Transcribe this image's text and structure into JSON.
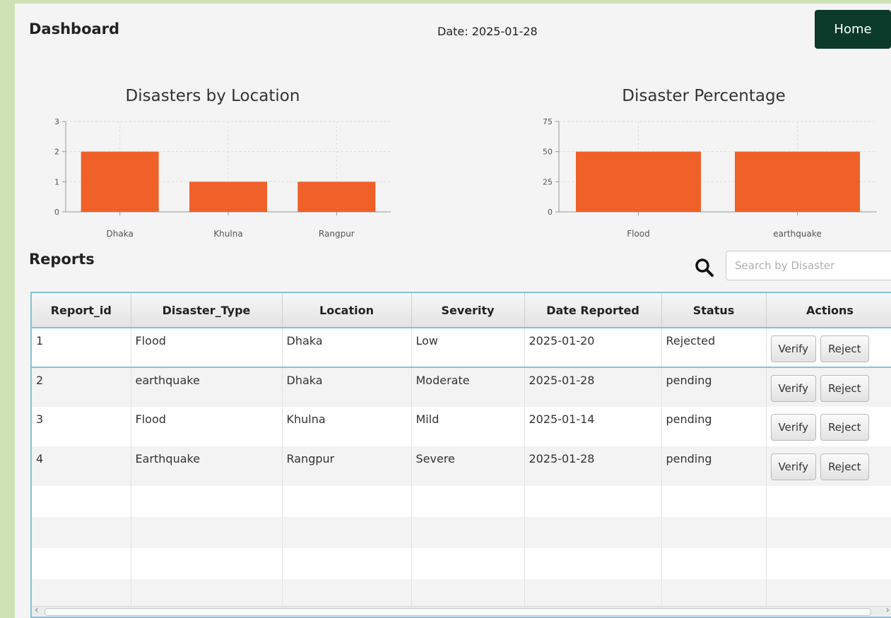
{
  "header": {
    "title": "Dashboard",
    "date": "Date: 2025-01-28",
    "home_label": "Home"
  },
  "chart_data": [
    {
      "type": "bar",
      "title": "Disasters by Location",
      "categories": [
        "Dhaka",
        "Khulna",
        "Rangpur"
      ],
      "values": [
        2,
        1,
        1
      ],
      "yticks": [
        0,
        1,
        2,
        3
      ],
      "ylim": [
        0,
        3
      ],
      "grid": true,
      "color": "#f06029"
    },
    {
      "type": "bar",
      "title": "Disaster Percentage",
      "categories": [
        "Flood",
        "earthquake"
      ],
      "values": [
        50,
        50
      ],
      "yticks": [
        0,
        25,
        50,
        75
      ],
      "ylim": [
        0,
        75
      ],
      "grid": true,
      "color": "#f06029"
    }
  ],
  "reports": {
    "title": "Reports",
    "search_placeholder": "Search by Disaster",
    "columns": [
      "Report_id",
      "Disaster_Type",
      "Location",
      "Severity",
      "Date Reported",
      "Status",
      "Actions"
    ],
    "rows": [
      {
        "id": "1",
        "type": "Flood",
        "location": "Dhaka",
        "severity": "Low",
        "date": "2025-01-20",
        "status": "Rejected"
      },
      {
        "id": "2",
        "type": "earthquake",
        "location": "Dhaka",
        "severity": "Moderate",
        "date": "2025-01-28",
        "status": "pending"
      },
      {
        "id": "3",
        "type": "Flood",
        "location": "Khulna",
        "severity": "Mild",
        "date": "2025-01-14",
        "status": "pending"
      },
      {
        "id": "4",
        "type": "Earthquake",
        "location": "Rangpur",
        "severity": "Severe",
        "date": "2025-01-28",
        "status": "pending"
      }
    ],
    "verify_label": "Verify",
    "reject_label": "Reject"
  },
  "colors": {
    "bar": "#f06029",
    "home_button": "#0b3a2a",
    "table_border": "#7fc4d8"
  }
}
